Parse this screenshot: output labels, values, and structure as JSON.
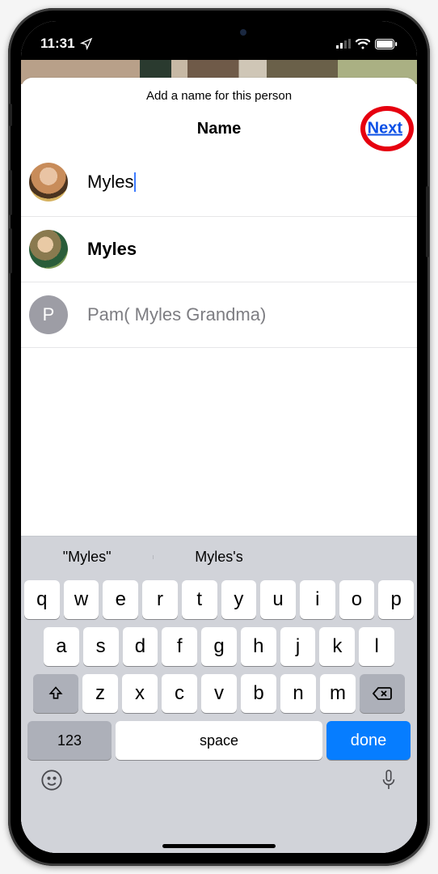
{
  "status": {
    "time": "11:31",
    "navigation_icon": "location-arrow-icon",
    "signal_icon": "cell-signal-icon",
    "wifi_icon": "wifi-icon",
    "battery_icon": "battery-icon"
  },
  "sheet": {
    "prompt": "Add a name for this person",
    "title": "Name",
    "next_label": "Next",
    "input_value": "Myles"
  },
  "suggestions": [
    {
      "label": "Myles",
      "avatar_type": "photo",
      "avatar_initial": ""
    },
    {
      "label": "Pam( Myles Grandma)",
      "avatar_type": "initial",
      "avatar_initial": "P"
    }
  ],
  "predictions": [
    "\"Myles\"",
    "Myles's",
    ""
  ],
  "keyboard": {
    "row1": [
      "q",
      "w",
      "e",
      "r",
      "t",
      "y",
      "u",
      "i",
      "o",
      "p"
    ],
    "row2": [
      "a",
      "s",
      "d",
      "f",
      "g",
      "h",
      "j",
      "k",
      "l"
    ],
    "row3": [
      "z",
      "x",
      "c",
      "v",
      "b",
      "n",
      "m"
    ],
    "shift_icon": "shift-icon",
    "backspace_icon": "backspace-icon",
    "numbers_label": "123",
    "space_label": "space",
    "done_label": "done",
    "emoji_icon": "emoji-icon",
    "mic_icon": "mic-icon"
  },
  "annotation": {
    "highlight_target": "Next"
  }
}
